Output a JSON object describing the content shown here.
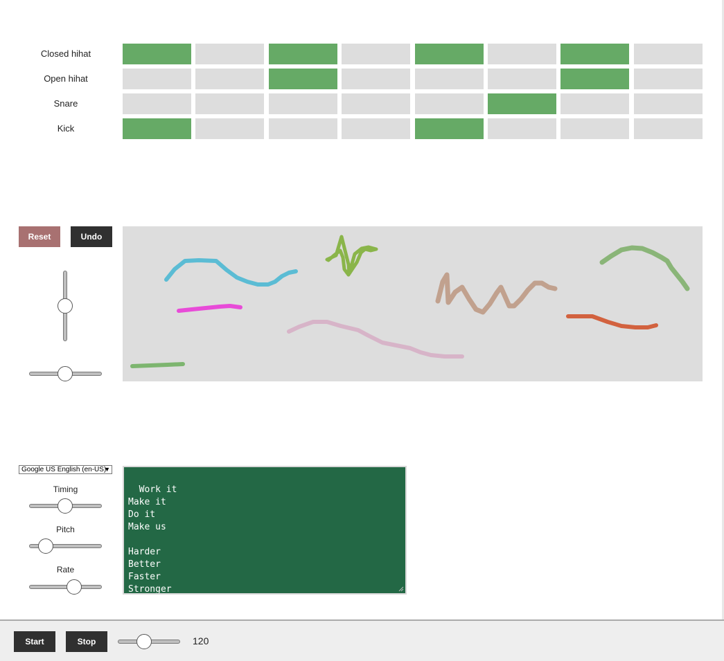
{
  "sequencer": {
    "rows": [
      {
        "label": "Closed hihat",
        "steps": [
          1,
          0,
          1,
          0,
          1,
          0,
          1,
          0
        ]
      },
      {
        "label": "Open hihat",
        "steps": [
          0,
          0,
          1,
          0,
          0,
          0,
          1,
          0
        ]
      },
      {
        "label": "Snare",
        "steps": [
          0,
          0,
          0,
          0,
          0,
          1,
          0,
          0
        ]
      },
      {
        "label": "Kick",
        "steps": [
          1,
          0,
          0,
          0,
          1,
          0,
          0,
          0
        ]
      }
    ],
    "active_color": "#66aa66",
    "inactive_color": "#dddddd"
  },
  "draw": {
    "reset_label": "Reset",
    "undo_label": "Undo",
    "vertical_slider_value": 0.5,
    "horizontal_slider_value": 0.5
  },
  "speech": {
    "voice": "Google US English (en-US)",
    "timing_label": "Timing",
    "pitch_label": "Pitch",
    "rate_label": "Rate",
    "timing_value": 0.5,
    "pitch_value": 0.2,
    "rate_value": 0.63,
    "lyrics": "Work it\nMake it\nDo it\nMake us\n\nHarder\nBetter\nFaster\nStronger"
  },
  "transport": {
    "start_label": "Start",
    "stop_label": "Stop",
    "tempo": "120",
    "tempo_slider_value": 0.42
  }
}
